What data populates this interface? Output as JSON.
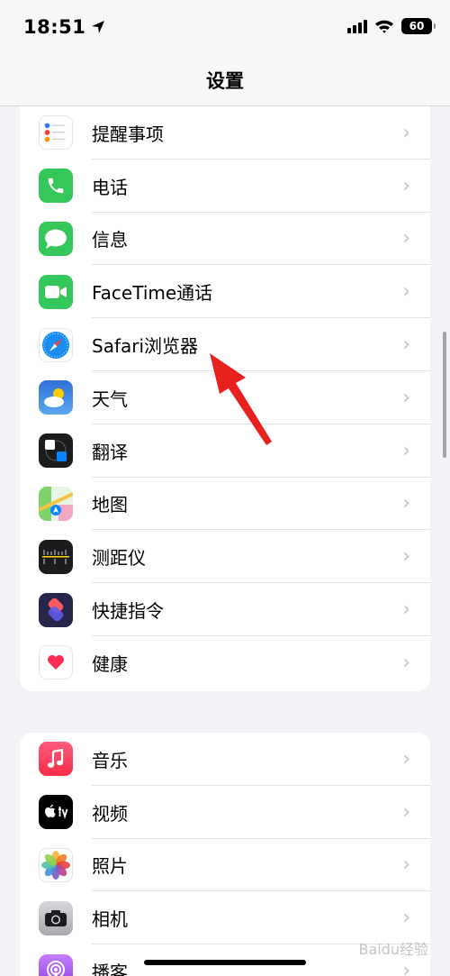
{
  "status_bar": {
    "time": "18:51",
    "battery": "60"
  },
  "header": {
    "title": "设置"
  },
  "group1": [
    {
      "label": "提醒事项",
      "icon": "reminders-icon"
    },
    {
      "label": "电话",
      "icon": "phone-icon"
    },
    {
      "label": "信息",
      "icon": "messages-icon"
    },
    {
      "label": "FaceTime通话",
      "icon": "facetime-icon"
    },
    {
      "label": "Safari浏览器",
      "icon": "safari-icon"
    },
    {
      "label": "天气",
      "icon": "weather-icon"
    },
    {
      "label": "翻译",
      "icon": "translate-icon"
    },
    {
      "label": "地图",
      "icon": "maps-icon"
    },
    {
      "label": "测距仪",
      "icon": "measure-icon"
    },
    {
      "label": "快捷指令",
      "icon": "shortcuts-icon"
    },
    {
      "label": "健康",
      "icon": "health-icon"
    }
  ],
  "group2": [
    {
      "label": "音乐",
      "icon": "music-icon"
    },
    {
      "label": "视频",
      "icon": "tv-icon"
    },
    {
      "label": "照片",
      "icon": "photos-icon"
    },
    {
      "label": "相机",
      "icon": "camera-icon"
    },
    {
      "label": "播客",
      "icon": "podcasts-icon"
    }
  ],
  "watermark": "Baidu经验",
  "colors": {
    "accent_arrow": "#e8211e",
    "chevron": "#c4c4c7",
    "background": "#f2f2f7"
  }
}
